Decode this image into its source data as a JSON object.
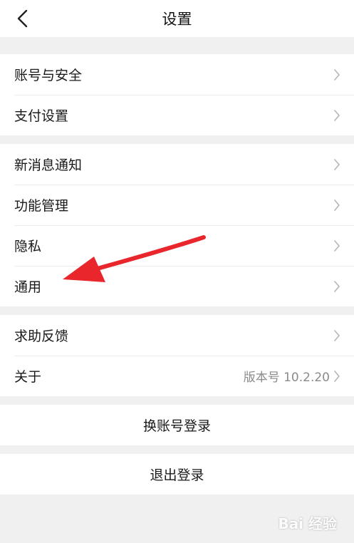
{
  "header": {
    "title": "设置",
    "back_icon": "chevron-left-icon"
  },
  "groups": [
    {
      "items": [
        {
          "label": "账号与安全"
        },
        {
          "label": "支付设置"
        }
      ]
    },
    {
      "items": [
        {
          "label": "新消息通知"
        },
        {
          "label": "功能管理"
        },
        {
          "label": "隐私"
        },
        {
          "label": "通用"
        }
      ]
    },
    {
      "items": [
        {
          "label": "求助反馈"
        },
        {
          "label": "关于",
          "value": "版本号 10.2.20"
        }
      ]
    }
  ],
  "actions": {
    "switch_account": "换账号登录",
    "logout": "退出登录"
  },
  "annotation": {
    "arrow_color": "#e8262b",
    "target": "通用"
  },
  "watermark": {
    "text": "Bai 经验"
  },
  "colors": {
    "background": "#f0f0f0",
    "card": "#ffffff",
    "text": "#1a1a1a",
    "secondary_text": "#8a8a8a",
    "chevron": "#b5b5b5"
  }
}
